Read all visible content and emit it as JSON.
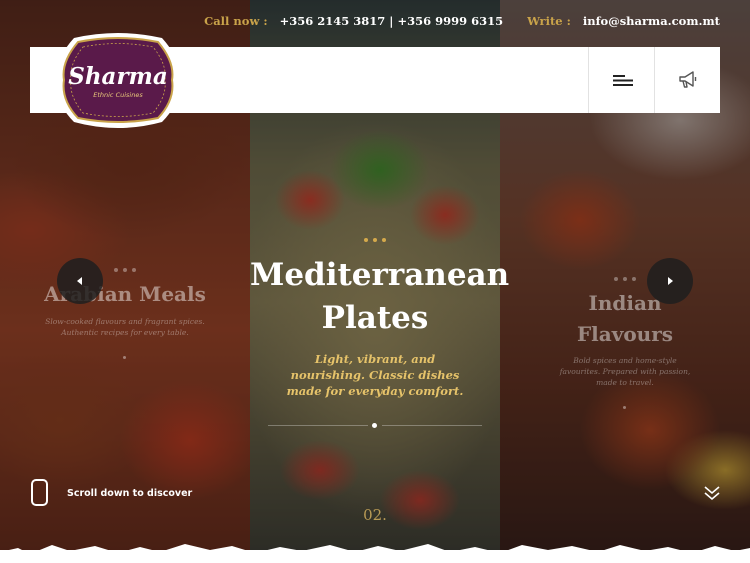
{
  "contact": {
    "call_label": "Call now :",
    "phones": "+356 2145 3817 | +356 9999 6315",
    "write_label": "Write :",
    "email": "info@sharma.com.mt"
  },
  "logo": {
    "name": "Sharma",
    "tagline": "Ethnic Cuisines"
  },
  "header": {
    "menu_icon": "hamburger-menu-icon",
    "announce_icon": "megaphone-icon"
  },
  "slides": {
    "left": {
      "title": "Arabian Meals",
      "description": "Slow-cooked flavours and fragrant spices. Authentic recipes for every table."
    },
    "center": {
      "title_line1": "Mediterranean",
      "title_line2": "Plates",
      "description": "Light, vibrant, and nourishing. Classic dishes made for everyday comfort.",
      "number": "02."
    },
    "right": {
      "title_line1": "Indian",
      "title_line2": "Flavours",
      "description": "Bold spices and home-style favourites. Prepared with passion, made to travel."
    }
  },
  "scroll": {
    "label": "Scroll down to discover"
  },
  "colors": {
    "gold": "#c9a34a",
    "logo_purple": "#5a1a4a",
    "dark_button": "#1e1e1e"
  }
}
